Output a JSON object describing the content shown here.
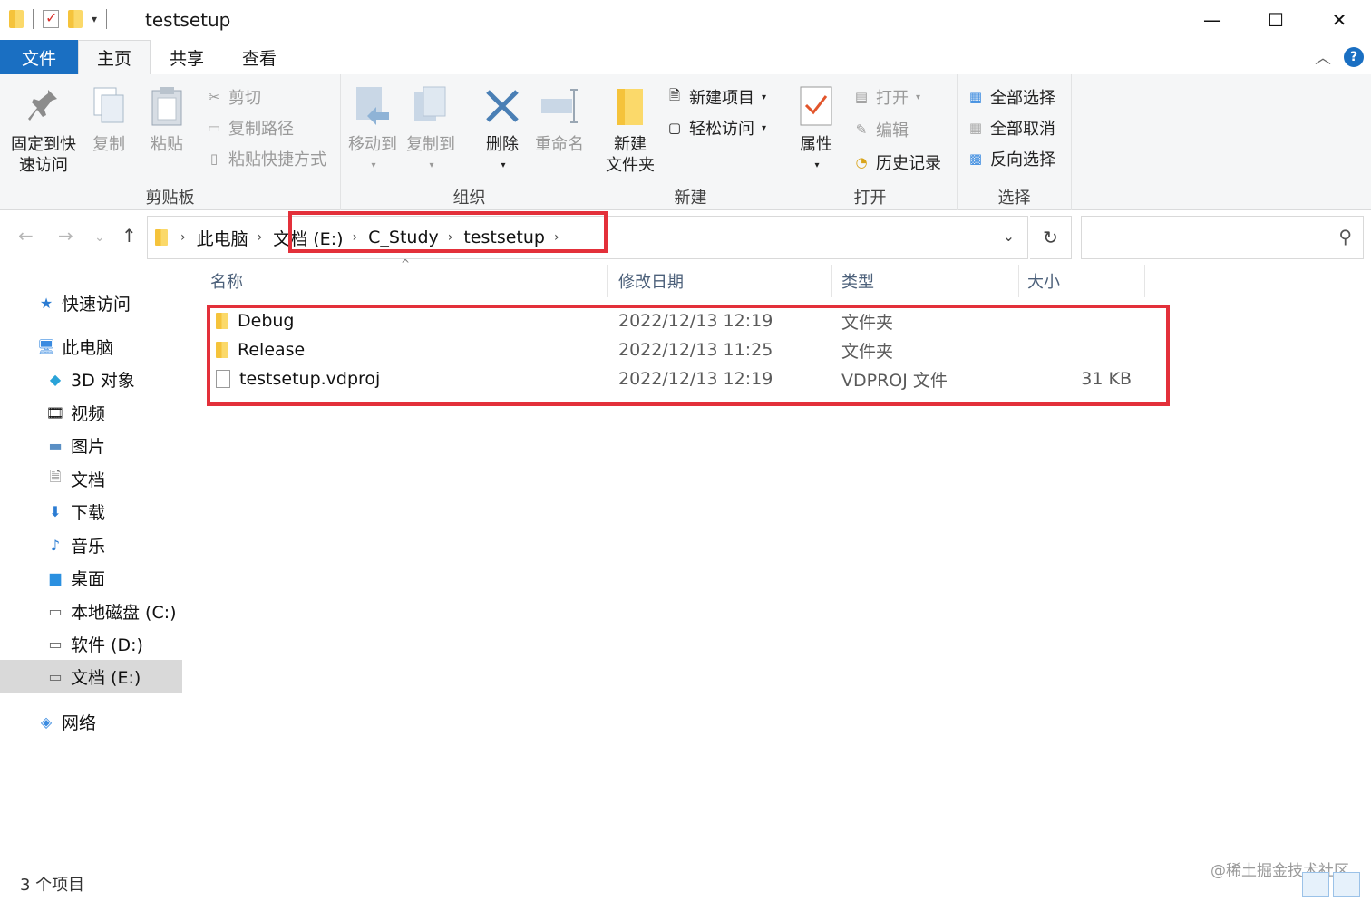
{
  "window": {
    "title": "testsetup",
    "minimize": "—",
    "maximize": "☐",
    "close": "✕"
  },
  "tabs": {
    "file": "文件",
    "home": "主页",
    "share": "共享",
    "view": "查看"
  },
  "ribbon": {
    "clipboard": {
      "label": "剪贴板",
      "pin_line1": "固定到快",
      "pin_line2": "速访问",
      "copy": "复制",
      "paste": "粘贴",
      "cut": "剪切",
      "copy_path": "复制路径",
      "paste_shortcut": "粘贴快捷方式"
    },
    "organize": {
      "label": "组织",
      "move_to": "移动到",
      "copy_to": "复制到",
      "delete": "删除",
      "rename": "重命名"
    },
    "new": {
      "label": "新建",
      "new_folder_line1": "新建",
      "new_folder_line2": "文件夹",
      "new_item": "新建项目",
      "easy_access": "轻松访问"
    },
    "open": {
      "label": "打开",
      "properties": "属性",
      "open": "打开",
      "edit": "编辑",
      "history": "历史记录"
    },
    "select": {
      "label": "选择",
      "select_all": "全部选择",
      "select_none": "全部取消",
      "invert": "反向选择"
    }
  },
  "address": {
    "crumbs": [
      "此电脑",
      "文档 (E:)",
      "C_Study",
      "testsetup"
    ],
    "search_placeholder": ""
  },
  "columns": {
    "name": "名称",
    "date": "修改日期",
    "type": "类型",
    "size": "大小"
  },
  "files": [
    {
      "name": "Debug",
      "date": "2022/12/13 12:19",
      "type": "文件夹",
      "size": "",
      "kind": "folder"
    },
    {
      "name": "Release",
      "date": "2022/12/13 11:25",
      "type": "文件夹",
      "size": "",
      "kind": "folder"
    },
    {
      "name": "testsetup.vdproj",
      "date": "2022/12/13 12:19",
      "type": "VDPROJ 文件",
      "size": "31 KB",
      "kind": "file"
    }
  ],
  "nav": {
    "quick_access": "快速访问",
    "this_pc": "此电脑",
    "objects3d": "3D 对象",
    "videos": "视频",
    "pictures": "图片",
    "documents": "文档",
    "downloads": "下载",
    "music": "音乐",
    "desktop": "桌面",
    "drive_c": "本地磁盘 (C:)",
    "drive_d": "软件 (D:)",
    "drive_e": "文档 (E:)",
    "network": "网络"
  },
  "status": {
    "count": "3 个项目"
  },
  "watermark": "@稀土掘金技术社区",
  "colors": {
    "accent": "#1a6fc2",
    "highlight": "#e3303a",
    "selected_nav": "#d9d9d9"
  }
}
